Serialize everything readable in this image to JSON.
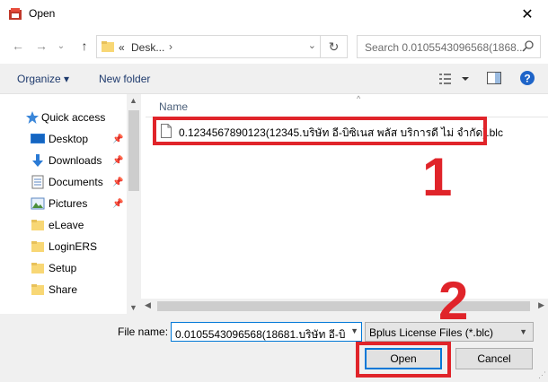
{
  "window": {
    "title": "Open",
    "close_glyph": "✕"
  },
  "nav": {
    "back_glyph": "←",
    "forward_glyph": "→",
    "recent_glyph": "⌄",
    "up_glyph": "↑",
    "address_prefix": "«",
    "address_text": "Desk...",
    "address_sep": "›",
    "refresh_glyph": "↻",
    "search_placeholder": "Search 0.0105543096568(1868..."
  },
  "toolbar": {
    "organize_label": "Organize ▾",
    "new_folder_label": "New folder"
  },
  "sidebar": {
    "items": [
      {
        "label": "Quick access",
        "icon": "star-icon",
        "pinned": false
      },
      {
        "label": "Desktop",
        "icon": "desktop-icon",
        "pinned": true
      },
      {
        "label": "Downloads",
        "icon": "download-icon",
        "pinned": true
      },
      {
        "label": "Documents",
        "icon": "document-icon",
        "pinned": true
      },
      {
        "label": "Pictures",
        "icon": "pictures-icon",
        "pinned": true
      },
      {
        "label": "eLeave",
        "icon": "folder-icon",
        "pinned": false
      },
      {
        "label": "LoginERS",
        "icon": "folder-icon",
        "pinned": false
      },
      {
        "label": "Setup",
        "icon": "folder-icon",
        "pinned": false
      },
      {
        "label": "Share",
        "icon": "folder-icon",
        "pinned": false
      }
    ],
    "pin_glyph": "📌"
  },
  "filelist": {
    "column_name": "Name",
    "sort_glyph": "^",
    "files": [
      {
        "name": "0.1234567890123(12345.บริษัท อี-บิซิเนส พลัส บริการดี ไม่ จำกัด).blc"
      }
    ]
  },
  "annotations": {
    "label_1": "1",
    "label_2": "2",
    "highlight_color": "#e0242a"
  },
  "footer": {
    "file_name_label": "File name:",
    "file_name_value": "0.0105543096568(18681.บริษัท อี-บิซิ",
    "file_type_value": "Bplus License Files (*.blc)",
    "open_label": "Open",
    "cancel_label": "Cancel"
  },
  "colors": {
    "accent": "#0078d7",
    "link": "#1e3a6d",
    "folder": "#f8d775"
  }
}
